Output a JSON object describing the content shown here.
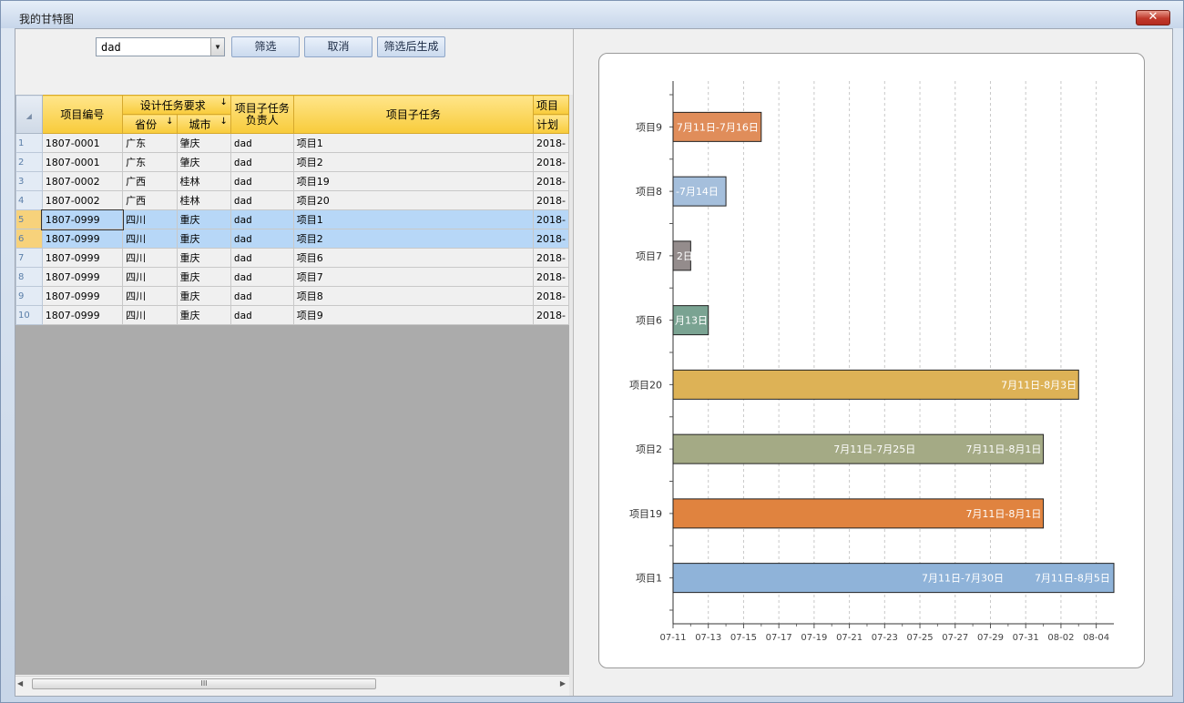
{
  "window": {
    "title": "我的甘特图",
    "close_label": "✕"
  },
  "filter": {
    "combo_value": "dad",
    "buttons": {
      "filter": "筛选",
      "cancel": "取消",
      "filter_generate": "筛选后生成"
    }
  },
  "grid": {
    "headers": {
      "project_no": "项目编号",
      "design_req": "设计任务要求",
      "province": "省份",
      "city": "城市",
      "owner": "项目子任务负责人",
      "subtask": "项目子任务",
      "plan_top": "项目",
      "plan_bottom": "计划"
    },
    "rows": [
      {
        "n": "1",
        "no": "1807-0001",
        "prov": "广东",
        "city": "肇庆",
        "owner": "dad",
        "task": "项目1",
        "plan": "2018-"
      },
      {
        "n": "2",
        "no": "1807-0001",
        "prov": "广东",
        "city": "肇庆",
        "owner": "dad",
        "task": "项目2",
        "plan": "2018-"
      },
      {
        "n": "3",
        "no": "1807-0002",
        "prov": "广西",
        "city": "桂林",
        "owner": "dad",
        "task": "项目19",
        "plan": "2018-"
      },
      {
        "n": "4",
        "no": "1807-0002",
        "prov": "广西",
        "city": "桂林",
        "owner": "dad",
        "task": "项目20",
        "plan": "2018-"
      },
      {
        "n": "5",
        "no": "1807-0999",
        "prov": "四川",
        "city": "重庆",
        "owner": "dad",
        "task": "项目1",
        "plan": "2018-"
      },
      {
        "n": "6",
        "no": "1807-0999",
        "prov": "四川",
        "city": "重庆",
        "owner": "dad",
        "task": "项目2",
        "plan": "2018-"
      },
      {
        "n": "7",
        "no": "1807-0999",
        "prov": "四川",
        "city": "重庆",
        "owner": "dad",
        "task": "项目6",
        "plan": "2018-"
      },
      {
        "n": "8",
        "no": "1807-0999",
        "prov": "四川",
        "city": "重庆",
        "owner": "dad",
        "task": "项目7",
        "plan": "2018-"
      },
      {
        "n": "9",
        "no": "1807-0999",
        "prov": "四川",
        "city": "重庆",
        "owner": "dad",
        "task": "项目8",
        "plan": "2018-"
      },
      {
        "n": "10",
        "no": "1807-0999",
        "prov": "四川",
        "city": "重庆",
        "owner": "dad",
        "task": "项目9",
        "plan": "2018-"
      }
    ]
  },
  "scroll": {
    "thumb_grip": "III",
    "left_arrow": "◀",
    "right_arrow": "▶"
  },
  "chart_data": {
    "type": "bar",
    "orientation": "horizontal",
    "x_ticks": [
      "07-11",
      "07-13",
      "07-15",
      "07-17",
      "07-19",
      "07-21",
      "07-23",
      "07-25",
      "07-27",
      "07-29",
      "07-31",
      "08-02",
      "08-04"
    ],
    "xlim_days": [
      0,
      25
    ],
    "grid": true,
    "tasks": [
      {
        "name": "项目9",
        "start": 0,
        "end": 5,
        "color": "#e08d5a",
        "labels": [
          {
            "text": "7月11日-7月16日",
            "at": 0.1
          }
        ]
      },
      {
        "name": "项目8",
        "start": 0,
        "end": 3,
        "color": "#a5bfdc",
        "labels": [
          {
            "text": "-7月14日",
            "at": 0.05
          }
        ]
      },
      {
        "name": "项目7",
        "start": 0,
        "end": 1,
        "color": "#948c8c",
        "labels": [
          {
            "text": "2日",
            "at": 0.1
          }
        ]
      },
      {
        "name": "项目6",
        "start": 0,
        "end": 2,
        "color": "#7aa392",
        "labels": [
          {
            "text": "月13日",
            "at": 0.0
          }
        ]
      },
      {
        "name": "项目20",
        "start": 0,
        "end": 23,
        "color": "#ddb256",
        "labels": [
          {
            "text": "7月11日-8月3日",
            "at": 18.5
          }
        ]
      },
      {
        "name": "项目2",
        "start": 0,
        "end": 21,
        "color": "#a4aa85",
        "labels": [
          {
            "text": "7月11日-7月25日",
            "at": 9.0
          },
          {
            "text": "7月11日-8月1日",
            "at": 16.5
          }
        ]
      },
      {
        "name": "项目19",
        "start": 0,
        "end": 21,
        "color": "#e0833f",
        "labels": [
          {
            "text": "7月11日-8月1日",
            "at": 16.5
          }
        ]
      },
      {
        "name": "项目1",
        "start": 0,
        "end": 25,
        "color": "#8fb3d9",
        "labels": [
          {
            "text": "7月11日-7月30日",
            "at": 14.0
          },
          {
            "text": "7月11日-8月5日",
            "at": 20.4
          }
        ]
      }
    ]
  }
}
